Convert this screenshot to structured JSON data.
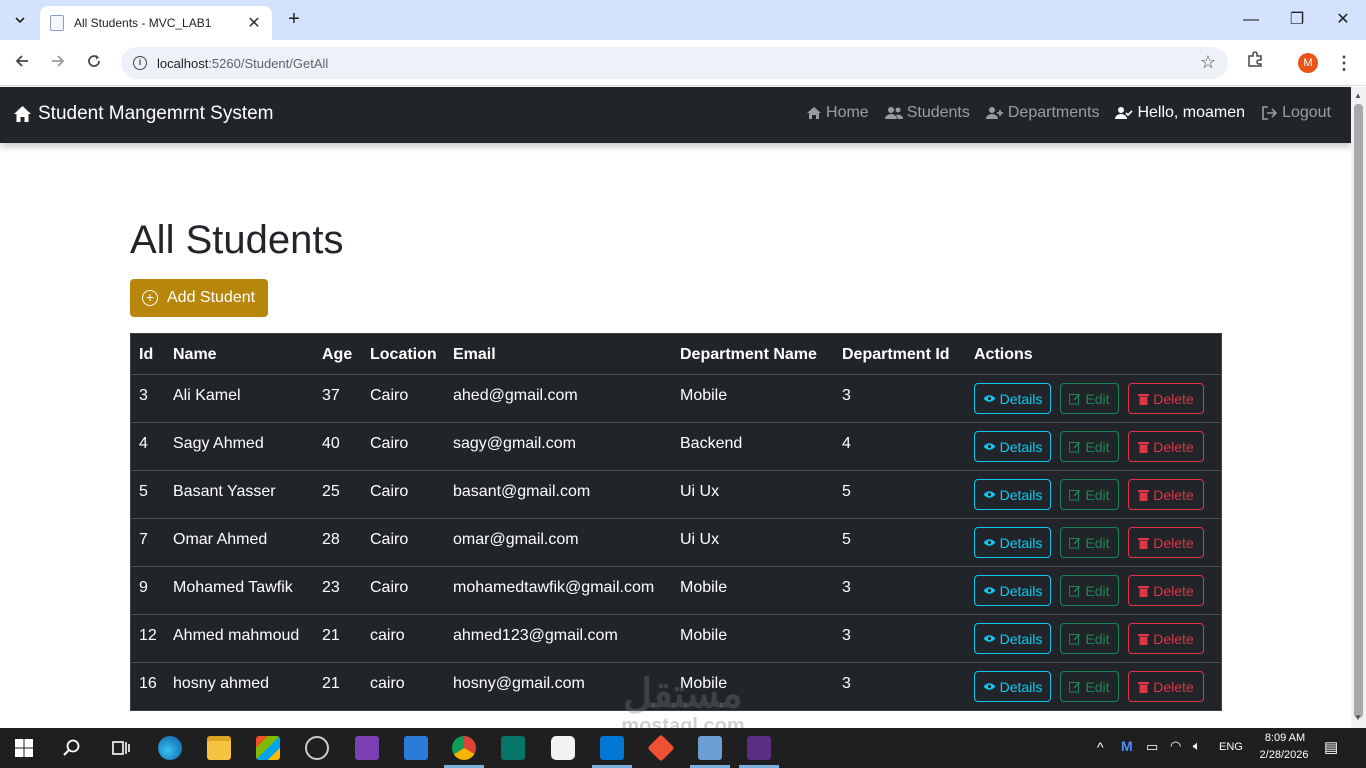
{
  "browser": {
    "tab_title": "All Students - MVC_LAB1",
    "tab_close": "✕",
    "new_tab": "+",
    "url_host": "localhost",
    "url_rest": ":5260/Student/GetAll",
    "minimize": "—",
    "restore": "❐",
    "close": "✕",
    "profile_initial": "M"
  },
  "navbar": {
    "brand": "Student Mangemrnt System",
    "links": {
      "home": "Home",
      "students": "Students",
      "departments": "Departments",
      "user": "Hello, moamen",
      "logout": "Logout"
    },
    "background": "#212529"
  },
  "page": {
    "title": "All Students",
    "add_button": "Add Student",
    "add_button_color": "#b8860b"
  },
  "table": {
    "columns": {
      "id": "Id",
      "name": "Name",
      "age": "Age",
      "location": "Location",
      "email": "Email",
      "department_name": "Department Name",
      "department_id": "Department Id",
      "actions": "Actions"
    },
    "action_labels": {
      "details": "Details",
      "edit": "Edit",
      "delete": "Delete"
    },
    "rows": [
      {
        "id": "3",
        "name": "Ali Kamel",
        "age": "37",
        "location": "Cairo",
        "email": "ahed@gmail.com",
        "department_name": "Mobile",
        "department_id": "3"
      },
      {
        "id": "4",
        "name": "Sagy Ahmed",
        "age": "40",
        "location": "Cairo",
        "email": "sagy@gmail.com",
        "department_name": "Backend",
        "department_id": "4"
      },
      {
        "id": "5",
        "name": "Basant Yasser",
        "age": "25",
        "location": "Cairo",
        "email": "basant@gmail.com",
        "department_name": "Ui Ux",
        "department_id": "5"
      },
      {
        "id": "7",
        "name": "Omar Ahmed",
        "age": "28",
        "location": "Cairo",
        "email": "omar@gmail.com",
        "department_name": "Ui Ux",
        "department_id": "5"
      },
      {
        "id": "9",
        "name": "Mohamed Tawfik",
        "age": "23",
        "location": "Cairo",
        "email": "mohamedtawfik@gmail.com",
        "department_name": "Mobile",
        "department_id": "3"
      },
      {
        "id": "12",
        "name": "Ahmed mahmoud",
        "age": "21",
        "location": "cairo",
        "email": "ahmed123@gmail.com",
        "department_name": "Mobile",
        "department_id": "3"
      },
      {
        "id": "16",
        "name": "hosny ahmed",
        "age": "21",
        "location": "cairo",
        "email": "hosny@gmail.com",
        "department_name": "Mobile",
        "department_id": "3"
      }
    ],
    "colors": {
      "details": "#0dcaf0",
      "edit": "#198754",
      "delete": "#dc3545"
    }
  },
  "watermark": {
    "text": "مستقل",
    "sub": "mostaql.com"
  },
  "taskbar": {
    "time": "8:09 AM",
    "date": "2/28/2026",
    "language": "ENG",
    "icons": [
      "windows-start-icon",
      "search-icon",
      "task-view-icon",
      "edge-icon",
      "file-explorer-icon",
      "store-icon",
      "obs-icon",
      "visual-studio-icon",
      "xampp-icon",
      "chrome-icon",
      "publisher-icon",
      "camera-icon",
      "vscode-icon",
      "git-icon",
      "photos-icon",
      "sql-icon"
    ]
  }
}
